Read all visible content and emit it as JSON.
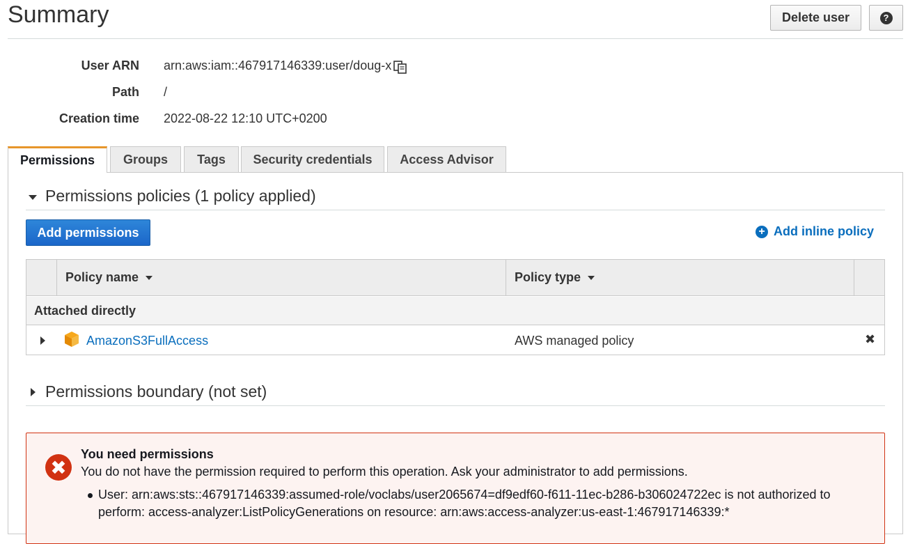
{
  "header": {
    "title": "Summary",
    "delete_label": "Delete user",
    "help_label": "?"
  },
  "summary": {
    "user_arn_label": "User ARN",
    "user_arn_value": "arn:aws:iam::467917146339:user/doug-x",
    "path_label": "Path",
    "path_value": "/",
    "creation_label": "Creation time",
    "creation_value": "2022-08-22 12:10 UTC+0200"
  },
  "tabs": [
    {
      "label": "Permissions",
      "active": true
    },
    {
      "label": "Groups",
      "active": false
    },
    {
      "label": "Tags",
      "active": false
    },
    {
      "label": "Security credentials",
      "active": false
    },
    {
      "label": "Access Advisor",
      "active": false
    }
  ],
  "permissions": {
    "section_title": "Permissions policies (1 policy applied)",
    "add_button": "Add permissions",
    "add_inline": "Add inline policy",
    "columns": [
      "Policy name",
      "Policy type"
    ],
    "group_label": "Attached directly",
    "rows": [
      {
        "name": "AmazonS3FullAccess",
        "type": "AWS managed policy",
        "remove": "✖"
      }
    ],
    "boundary_title": "Permissions boundary (not set)"
  },
  "alert": {
    "icon": "✖",
    "title": "You need permissions",
    "message": "You do not have the permission required to perform this operation. Ask your administrator to add permissions.",
    "detail": "User: arn:aws:sts::467917146339:assumed-role/voclabs/user2065674=df9edf60-f611-11ec-b286-b306024722ec is not authorized to perform: access-analyzer:ListPolicyGenerations on resource: arn:aws:access-analyzer:us-east-1:467917146339:*"
  },
  "colors": {
    "accent_tab": "#e7962b",
    "primary_button": "#1b66c9",
    "link": "#0a6ebd",
    "error": "#d13212",
    "error_bg": "#fdf3f1"
  }
}
